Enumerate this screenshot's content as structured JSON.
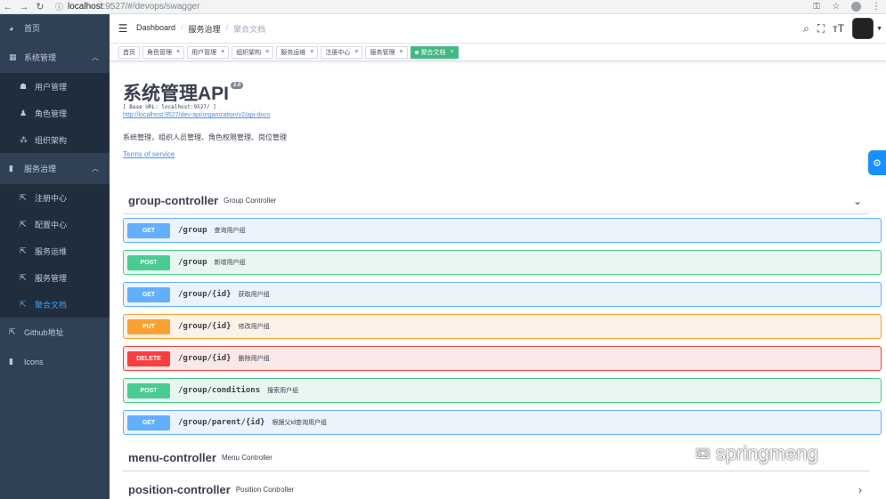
{
  "browser": {
    "url_host": "localhost",
    "url_path": ":9527/#/devops/swagger"
  },
  "sidebar": {
    "items": [
      {
        "label": "首页",
        "icon": "dashboard-icon"
      },
      {
        "label": "系统管理",
        "icon": "grid-icon",
        "expanded": true,
        "children": [
          {
            "label": "用户管理",
            "icon": "users-icon"
          },
          {
            "label": "角色管理",
            "icon": "role-icon"
          },
          {
            "label": "组织架构",
            "icon": "tree-icon"
          }
        ]
      },
      {
        "label": "服务治理",
        "icon": "chart-icon",
        "expanded": true,
        "children": [
          {
            "label": "注册中心",
            "icon": "external-link-icon"
          },
          {
            "label": "配置中心",
            "icon": "external-link-icon"
          },
          {
            "label": "服务运维",
            "icon": "external-link-icon"
          },
          {
            "label": "服务管理",
            "icon": "external-link-icon"
          },
          {
            "label": "聚合文档",
            "icon": "external-link-icon",
            "active": true
          }
        ]
      },
      {
        "label": "Github地址",
        "icon": "external-link-icon"
      },
      {
        "label": "Icons",
        "icon": "icons-icon"
      }
    ]
  },
  "breadcrumb": {
    "items": [
      "Dashboard",
      "服务治理",
      "聚合文档"
    ]
  },
  "tags": [
    {
      "label": "首页",
      "closable": false
    },
    {
      "label": "角色管理",
      "closable": true
    },
    {
      "label": "用户管理",
      "closable": true
    },
    {
      "label": "组织架构",
      "closable": true
    },
    {
      "label": "服务运维",
      "closable": true
    },
    {
      "label": "注册中心",
      "closable": true
    },
    {
      "label": "服务管理",
      "closable": true
    },
    {
      "label": "聚合文档",
      "closable": true,
      "active": true
    }
  ],
  "api": {
    "title": "系统管理API",
    "version": "2.0",
    "base_url": "[ Base URL: localhost:9527/ ]",
    "docs_url": "http://localhost:9527/dev-api/organization/v2/api-docs",
    "description": "系统管理，组织人员管理、角色权限管理、岗位管理",
    "terms": "Terms of service"
  },
  "controllers": [
    {
      "name": "group-controller",
      "desc": "Group Controller",
      "chevron": "⌄"
    },
    {
      "name": "menu-controller",
      "desc": "Menu Controller",
      "chevron": ""
    },
    {
      "name": "position-controller",
      "desc": "Position Controller",
      "chevron": "›"
    }
  ],
  "operations": [
    {
      "method": "GET",
      "path": "/group",
      "summary": "查询用户组"
    },
    {
      "method": "POST",
      "path": "/group",
      "summary": "新增用户组"
    },
    {
      "method": "GET",
      "path": "/group/{id}",
      "summary": "获取用户组"
    },
    {
      "method": "PUT",
      "path": "/group/{id}",
      "summary": "修改用户组"
    },
    {
      "method": "DELETE",
      "path": "/group/{id}",
      "summary": "删除用户组"
    },
    {
      "method": "POST",
      "path": "/group/conditions",
      "summary": "搜索用户组"
    },
    {
      "method": "GET",
      "path": "/group/parent/{id}",
      "summary": "根据父id查询用户组"
    }
  ],
  "watermark": {
    "text": "springmeng"
  },
  "colors": {
    "sidebar_bg": "#304156",
    "active_link": "#409eff",
    "get": "#61affe",
    "post": "#49cc90",
    "put": "#fca130",
    "delete": "#f93e3e",
    "tag_active": "#42b983"
  }
}
